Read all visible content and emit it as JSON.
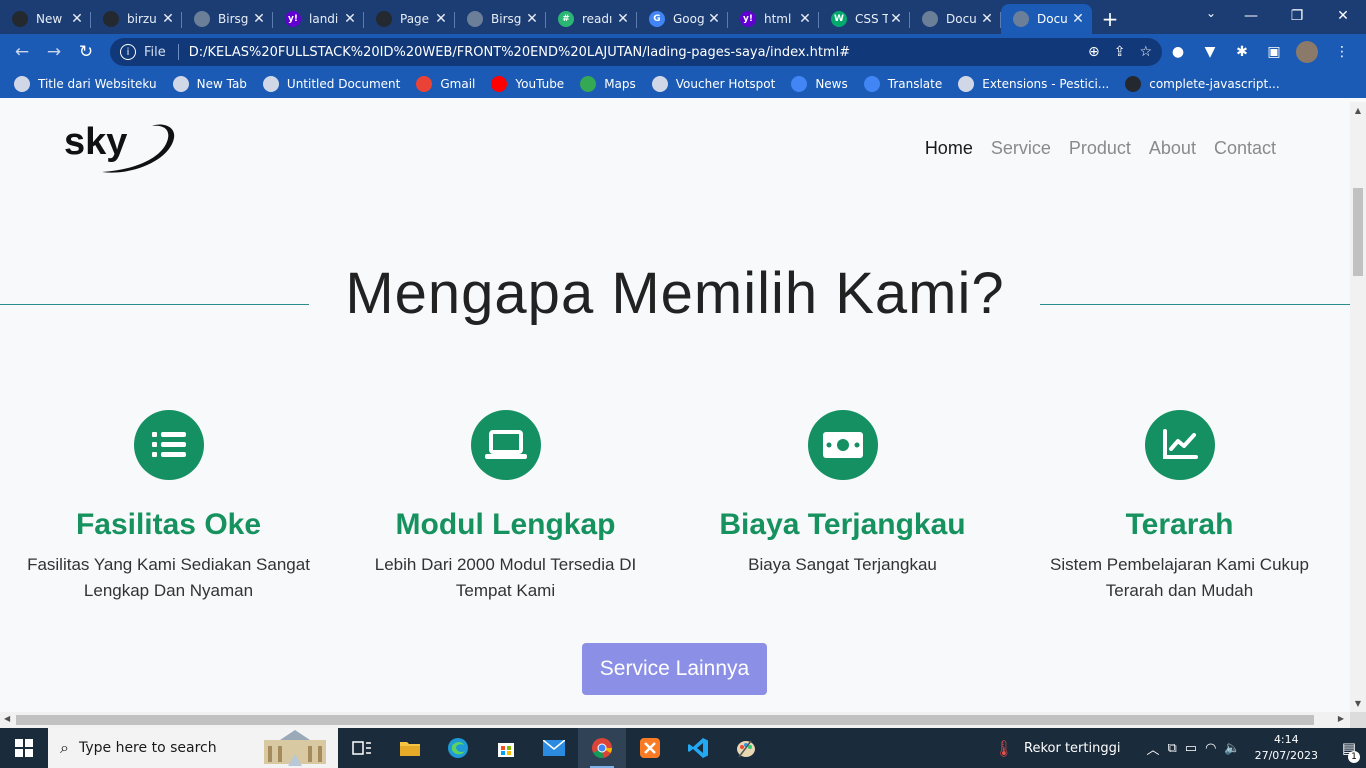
{
  "browser": {
    "tabs": [
      {
        "title": "New",
        "icon": "github-icon",
        "color": "#24292f",
        "glyph": ""
      },
      {
        "title": "birzu",
        "icon": "github-icon",
        "color": "#24292f",
        "glyph": ""
      },
      {
        "title": "Birsg",
        "icon": "globe-icon",
        "color": "#6b7f99",
        "glyph": ""
      },
      {
        "title": "landi",
        "icon": "yahoo-icon",
        "color": "#6001d2",
        "glyph": "y!"
      },
      {
        "title": "Page",
        "icon": "github-icon",
        "color": "#24292f",
        "glyph": ""
      },
      {
        "title": "Birsg",
        "icon": "globe-icon",
        "color": "#6b7f99",
        "glyph": ""
      },
      {
        "title": "readı",
        "icon": "hash-icon",
        "color": "#2bb673",
        "glyph": "#"
      },
      {
        "title": "Goog",
        "icon": "translate-icon",
        "color": "#4285f4",
        "glyph": "G"
      },
      {
        "title": "html",
        "icon": "yahoo-icon",
        "color": "#6001d2",
        "glyph": "y!"
      },
      {
        "title": "CSS T",
        "icon": "w3schools-icon",
        "color": "#04aa6d",
        "glyph": "W"
      },
      {
        "title": "Docu",
        "icon": "globe-icon",
        "color": "#6b7f99",
        "glyph": ""
      },
      {
        "title": "Docu",
        "icon": "globe-icon",
        "color": "#6b7f99",
        "glyph": "",
        "active": true
      }
    ],
    "url": "D:/KELAS%20FULLSTACK%20ID%20WEB/FRONT%20END%20LAJUTAN/lading-pages-saya/index.html#",
    "url_scheme_label": "File",
    "bookmarks": [
      {
        "label": "Title dari Websiteku",
        "icon": "globe-icon",
        "color": "#d0d8e8"
      },
      {
        "label": "New Tab",
        "icon": "globe-icon",
        "color": "#d0d8e8"
      },
      {
        "label": "Untitled Document",
        "icon": "globe-icon",
        "color": "#d0d8e8"
      },
      {
        "label": "Gmail",
        "icon": "gmail-icon",
        "color": "#ea4335"
      },
      {
        "label": "YouTube",
        "icon": "youtube-icon",
        "color": "#ff0000"
      },
      {
        "label": "Maps",
        "icon": "maps-icon",
        "color": "#34a853"
      },
      {
        "label": "Voucher Hotspot",
        "icon": "globe-icon",
        "color": "#d0d8e8"
      },
      {
        "label": "News",
        "icon": "news-icon",
        "color": "#4285f4"
      },
      {
        "label": "Translate",
        "icon": "translate-icon",
        "color": "#4285f4"
      },
      {
        "label": "Extensions - Pestici...",
        "icon": "puzzle-icon",
        "color": "#d0d8e8"
      },
      {
        "label": "complete-javascript...",
        "icon": "github-icon",
        "color": "#24292f"
      }
    ]
  },
  "page": {
    "logo_text": "sky",
    "nav": [
      {
        "label": "Home",
        "active": true
      },
      {
        "label": "Service"
      },
      {
        "label": "Product"
      },
      {
        "label": "About"
      },
      {
        "label": "Contact"
      }
    ],
    "heading": "Mengapa Memilih Kami?",
    "features": [
      {
        "icon": "list-icon",
        "title": "Fasilitas Oke",
        "desc": [
          "Fasilitas Yang Kami Sediakan Sangat",
          "Lengkap Dan Nyaman"
        ]
      },
      {
        "icon": "laptop-icon",
        "title": "Modul Lengkap",
        "desc": [
          "Lebih Dari 2000 Modul Tersedia DI",
          "Tempat Kami"
        ]
      },
      {
        "icon": "money-icon",
        "title": "Biaya Terjangkau",
        "desc": [
          "Biaya Sangat Terjangkau",
          ""
        ]
      },
      {
        "icon": "chart-line-icon",
        "title": "Terarah",
        "desc": [
          "Sistem Pembelajaran Kami Cukup",
          "Terarah dan Mudah"
        ]
      }
    ],
    "cta_label": "Service Lainnya",
    "colors": {
      "accent_green": "#16925f",
      "button": "#8c8fe6",
      "rule": "#2a8c8c"
    }
  },
  "taskbar": {
    "search_placeholder": "Type here to search",
    "weather_text": "Rekor tertinggi",
    "time": "4:14",
    "date": "27/07/2023",
    "notification_count": "1"
  }
}
